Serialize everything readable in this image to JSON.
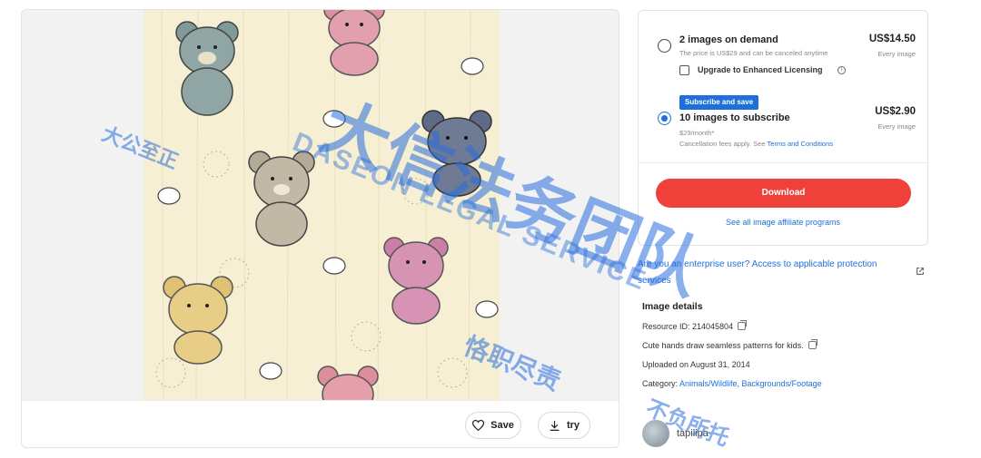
{
  "preview": {
    "save_label": "Save",
    "try_label": "try"
  },
  "purchase": {
    "on_demand": {
      "title": "2 images on demand",
      "subtitle": "The price is US$29 and can be canceled anytime",
      "price": "US$14.50",
      "price_sub": "Every image",
      "license_label": "Upgrade to Enhanced Licensing",
      "selected": false
    },
    "subscribe": {
      "badge": "Subscribe and save",
      "title": "10 images to subscribe",
      "subtitle": "$29/month*",
      "fees_text": "Cancellation fees apply. See ",
      "terms_link": "Terms and Conditions",
      "price": "US$2.90",
      "price_sub": "Every image",
      "selected": true
    },
    "download_label": "Download",
    "affiliate_link": "See all image affiliate programs"
  },
  "enterprise_link": "Are you an enterprise user? Access to applicable protection services",
  "details": {
    "title": "Image details",
    "resource_id": "Resource ID: 214045804",
    "description": "Cute hands draw seamless patterns for kids.",
    "uploaded": "Uploaded on August 31, 2014",
    "category_label": "Category: ",
    "category_value": "Animals/Wildlife, Backgrounds/Footage"
  },
  "author": {
    "name": "tapilipa"
  },
  "watermark": {
    "big": "大信法务团队",
    "small": "大公至正",
    "en": "DASEON LEGAL SERVICE",
    "motto": "恪职尽责",
    "motto2": "不负所托"
  },
  "colors": {
    "accent": "#1e6fd9",
    "download": "#f0403a",
    "watermark": "#286edc"
  }
}
